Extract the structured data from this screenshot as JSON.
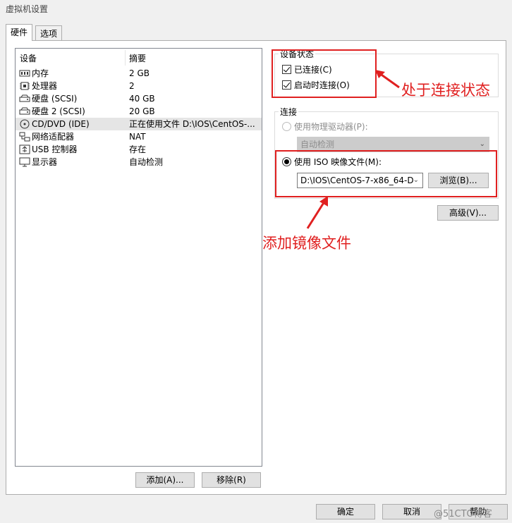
{
  "window": {
    "title": "虚拟机设置"
  },
  "tabs": [
    {
      "label": "硬件",
      "active": true
    },
    {
      "label": "选项",
      "active": false
    }
  ],
  "device_table": {
    "headers": [
      "设备",
      "摘要"
    ],
    "rows": [
      {
        "icon": "memory-icon",
        "name": "内存",
        "summary": "2 GB"
      },
      {
        "icon": "processor-icon",
        "name": "处理器",
        "summary": "2"
      },
      {
        "icon": "harddisk-icon",
        "name": "硬盘 (SCSI)",
        "summary": "40 GB"
      },
      {
        "icon": "harddisk-icon",
        "name": "硬盘 2 (SCSI)",
        "summary": "20 GB"
      },
      {
        "icon": "cd-dvd-icon",
        "name": "CD/DVD (IDE)",
        "summary": "正在使用文件 D:\\IOS\\CentOS-...",
        "selected": true
      },
      {
        "icon": "network-icon",
        "name": "网络适配器",
        "summary": "NAT"
      },
      {
        "icon": "usb-icon",
        "name": "USB 控制器",
        "summary": "存在"
      },
      {
        "icon": "display-icon",
        "name": "显示器",
        "summary": "自动检测"
      }
    ]
  },
  "list_buttons": {
    "add": "添加(A)...",
    "remove": "移除(R)"
  },
  "device_status": {
    "label": "设备状态",
    "connected": {
      "label": "已连接(C)",
      "checked": true
    },
    "connect_at_power_on": {
      "label": "启动时连接(O)",
      "checked": true
    }
  },
  "connection": {
    "label": "连接",
    "physical_drive": {
      "label": "使用物理驱动器(P):",
      "selected": false,
      "disabled": true
    },
    "physical_drive_combo": "自动检测",
    "iso_image": {
      "label": "使用 ISO 映像文件(M):",
      "selected": true
    },
    "iso_path": "D:\\IOS\\CentOS-7-x86_64-D",
    "browse_button": "浏览(B)...",
    "advanced_button": "高级(V)..."
  },
  "annotations": {
    "status_note": "处于连接状态",
    "iso_note": "添加镜像文件",
    "color": "#e02020"
  },
  "footer": {
    "ok": "确定",
    "cancel": "取消",
    "help": "帮助"
  },
  "watermark": "@51CTO博客"
}
